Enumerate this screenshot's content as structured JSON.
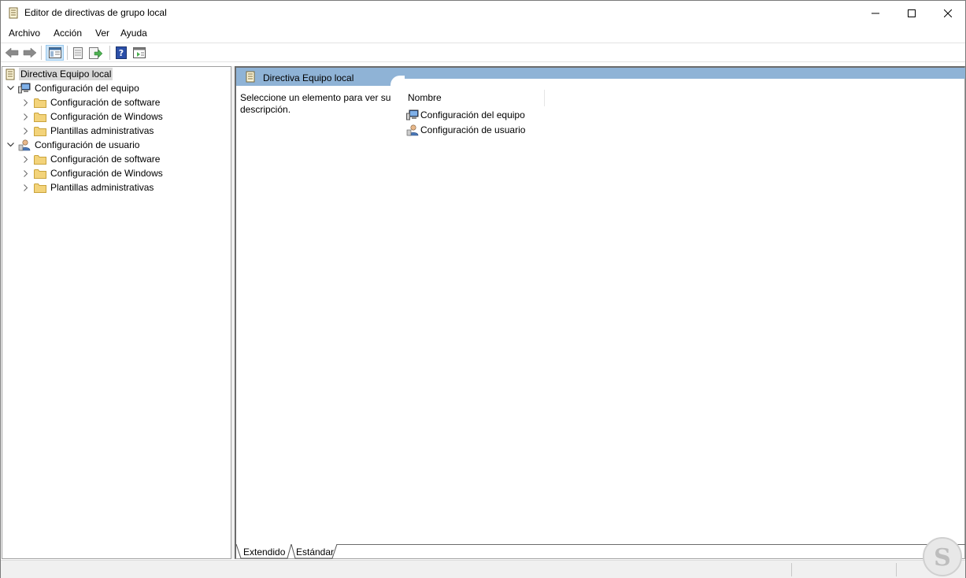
{
  "window": {
    "title": "Editor de directivas de grupo local"
  },
  "menu": {
    "items": [
      "Archivo",
      "Acción",
      "Ver",
      "Ayuda"
    ]
  },
  "toolbar": {
    "buttons": [
      "back-icon",
      "forward-icon",
      "show-hide-tree-icon",
      "properties-icon",
      "export-list-icon",
      "help-icon",
      "extended-view-icon"
    ]
  },
  "tree": {
    "root": "Directiva Equipo local",
    "nodes": [
      {
        "label": "Configuración del equipo",
        "children": [
          "Configuración de software",
          "Configuración de Windows",
          "Plantillas administrativas"
        ]
      },
      {
        "label": "Configuración de usuario",
        "children": [
          "Configuración de software",
          "Configuración de Windows",
          "Plantillas administrativas"
        ]
      }
    ]
  },
  "content": {
    "header_title": "Directiva Equipo local",
    "description": "Seleccione un elemento para ver su descripción.",
    "column_header": "Nombre",
    "items": [
      "Configuración del equipo",
      "Configuración de usuario"
    ]
  },
  "tabs": [
    "Extendido",
    "Estándar"
  ],
  "colors": {
    "header_band": "#8fb3d6",
    "folder": "#f3d37a",
    "selection": "#d9d9d9"
  }
}
